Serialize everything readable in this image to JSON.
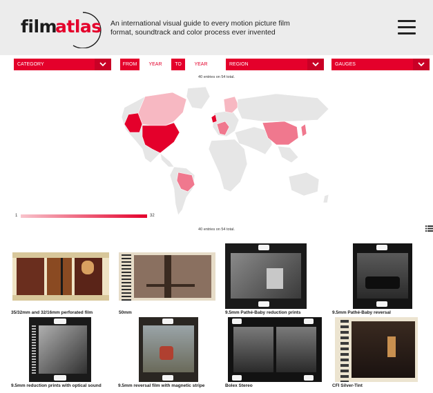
{
  "header": {
    "logo_film": "film",
    "logo_atlas": "atlas",
    "tagline": "An international visual guide to every motion picture film format, soundtrack and color process ever invented"
  },
  "filters": {
    "category": "CATEGORY",
    "from_label": "FROM",
    "from_placeholder": "YEAR",
    "to_label": "TO",
    "to_placeholder": "YEAR",
    "region": "REGION",
    "gauges": "GAUGES"
  },
  "entries_text": "40 entries on 54 total.",
  "legend": {
    "min": "1",
    "max": "32"
  },
  "colors": {
    "accent": "#e4002b",
    "map_light": "#f7b8c2",
    "map_mid": "#f0788e",
    "land": "#e6e6e6"
  },
  "cards": [
    {
      "title": "35/32mm and 32/16mm perforated film"
    },
    {
      "title": "50mm"
    },
    {
      "title": "9.5mm Pathé-Baby reduction prints"
    },
    {
      "title": "9.5mm Pathé-Baby reversal"
    },
    {
      "title": "9.5mm reduction prints with optical sound"
    },
    {
      "title": "9.5mm reversal film with magnetic stripe"
    },
    {
      "title": "Bolex Stereo"
    },
    {
      "title": "CFI Silver-Tint"
    }
  ]
}
